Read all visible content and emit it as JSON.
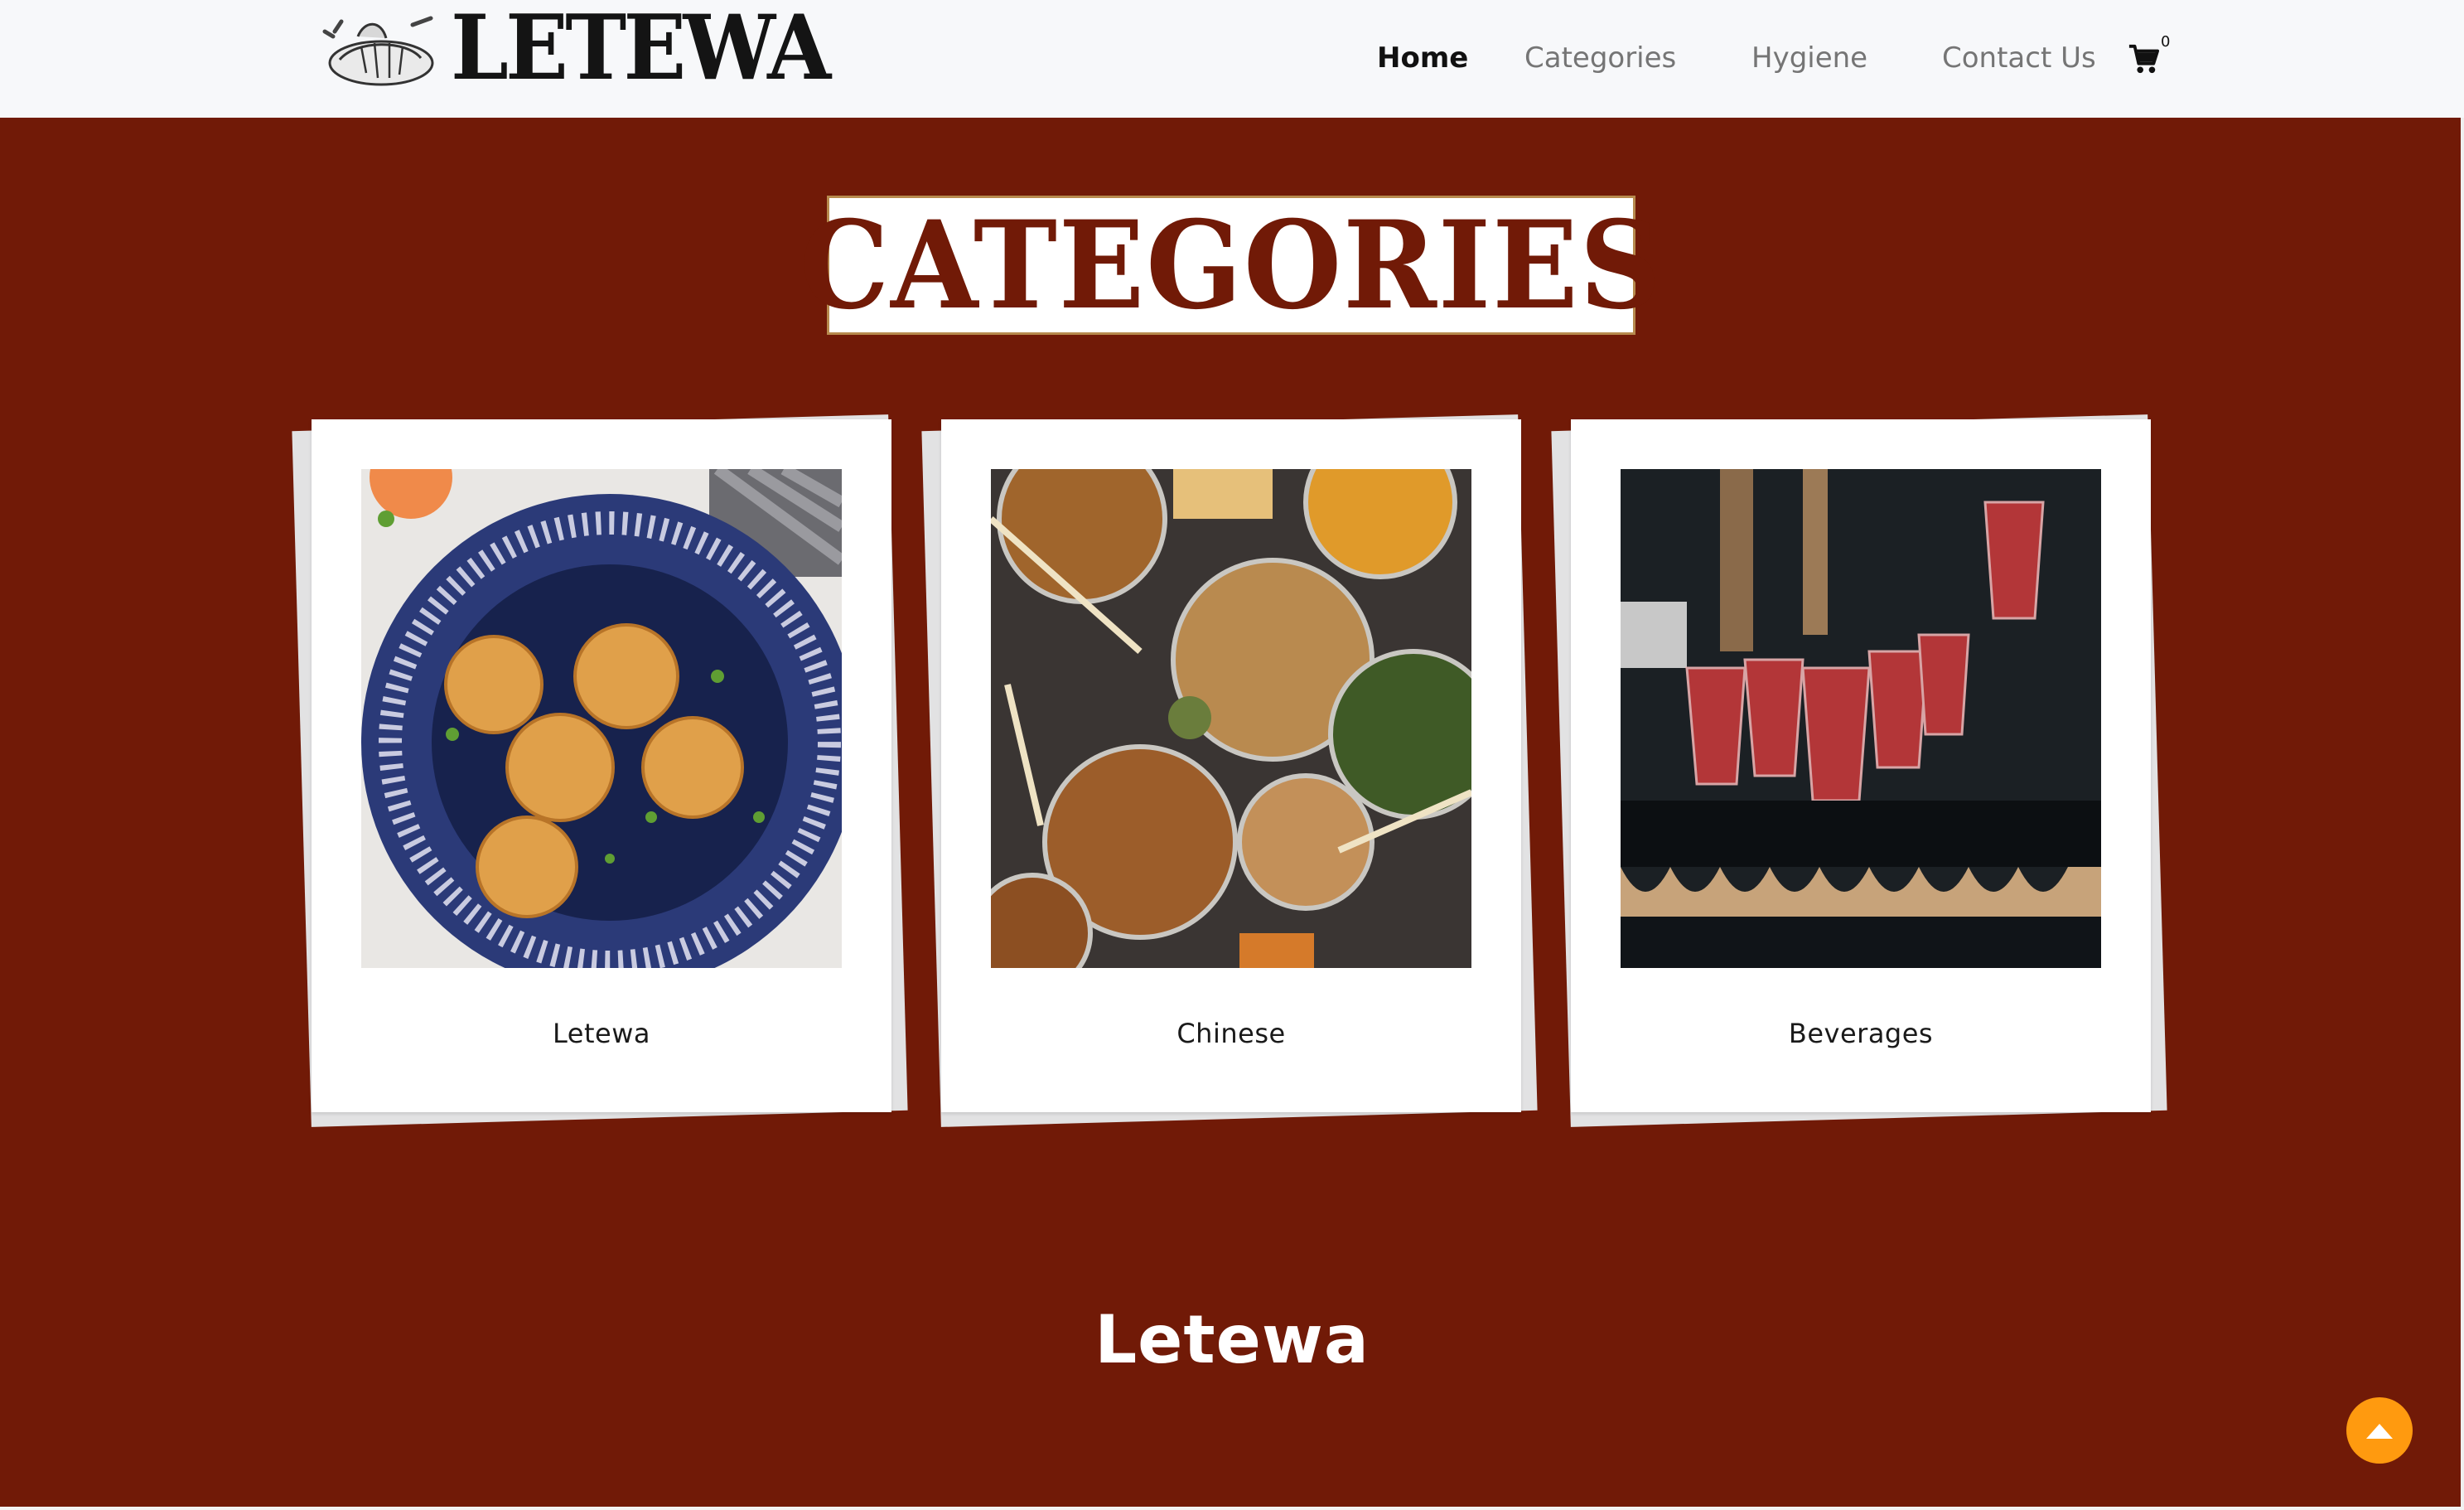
{
  "brand": {
    "name": "LETEWA",
    "logo_icon": "dumpling-icon"
  },
  "nav": {
    "items": [
      {
        "label": "Home",
        "active": true
      },
      {
        "label": "Categories",
        "active": false
      },
      {
        "label": "Hygiene",
        "active": false
      },
      {
        "label": "Contact Us",
        "active": false
      }
    ],
    "cart": {
      "icon": "cart-icon",
      "count": "0"
    }
  },
  "categories_title": "CATEGORIES",
  "cards": [
    {
      "label": "Letewa",
      "image": "momo-plate-photo"
    },
    {
      "label": "Chinese",
      "image": "noodle-bowls-photo"
    },
    {
      "label": "Beverages",
      "image": "drink-cups-photo"
    }
  ],
  "section_heading": "Letewa",
  "scroll_top": {
    "icon": "arrow-up-icon"
  },
  "colors": {
    "background": "#711a07",
    "header": "#f7f8fa",
    "accent": "#ff9a0f",
    "title_border": "#b78a4d"
  }
}
